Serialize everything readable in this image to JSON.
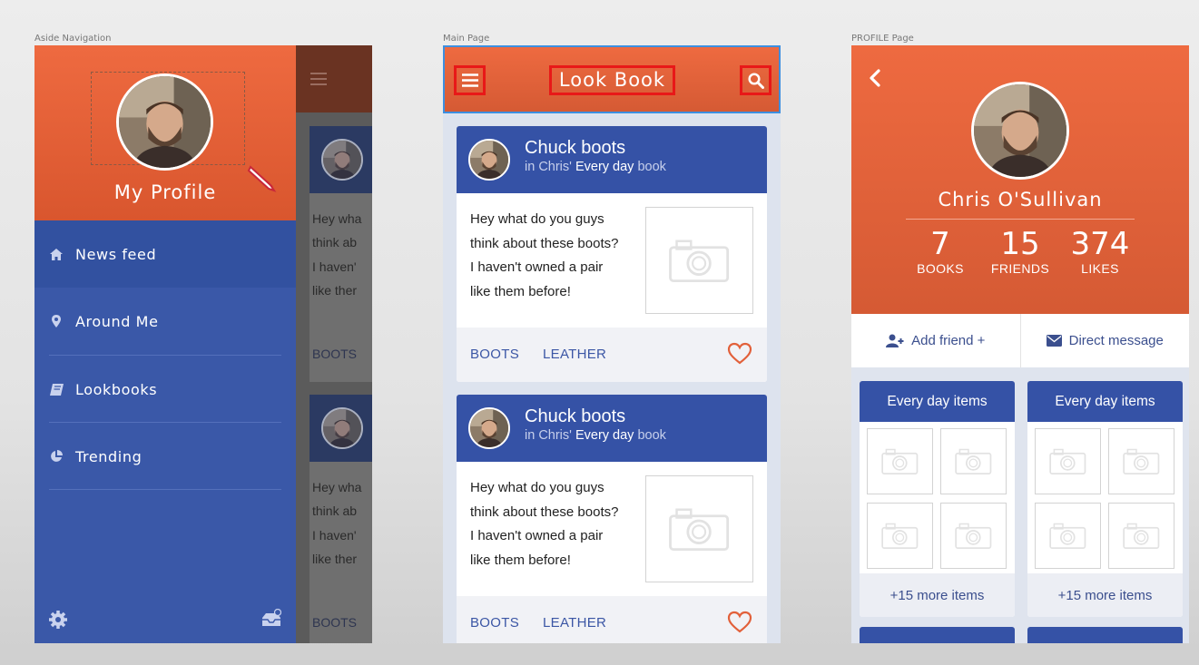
{
  "frames": {
    "aside_label": "Aside Navigation",
    "main_label": "Main Page",
    "profile_label": "PROFILE Page"
  },
  "aside": {
    "title": "My Profile",
    "items": [
      {
        "label": "News feed",
        "icon": "home-icon",
        "active": true
      },
      {
        "label": "Around Me",
        "icon": "map-pin-icon"
      },
      {
        "label": "Lookbooks",
        "icon": "book-icon"
      },
      {
        "label": "Trending",
        "icon": "pie-chart-icon"
      }
    ],
    "footer_icons": [
      "gear-icon",
      "inbox-icon"
    ],
    "peek_texts": [
      "Hey wha",
      "think ab",
      "I haven'",
      "like ther"
    ],
    "peek_tag": "BOOTS"
  },
  "main": {
    "title": "Look Book",
    "posts": [
      {
        "title": "Chuck boots",
        "sub_prefix": "in Chris' ",
        "sub_bold": "Every day",
        "sub_suffix": " book",
        "lines": [
          "Hey what do you guys",
          "think about these boots?",
          "I haven't owned a pair",
          "like them before!"
        ],
        "tags": [
          "BOOTS",
          "LEATHER"
        ]
      },
      {
        "title": "Chuck boots",
        "sub_prefix": "in Chris' ",
        "sub_bold": "Every day",
        "sub_suffix": " book",
        "lines": [
          "Hey what do you guys",
          "think about these boots?",
          "I haven't owned a pair",
          "like them before!"
        ],
        "tags": [
          "BOOTS",
          "LEATHER"
        ]
      }
    ]
  },
  "profile": {
    "name": "Chris O'Sullivan",
    "stats": [
      {
        "value": "7",
        "label": "BOOKS"
      },
      {
        "value": "15",
        "label": "FRIENDS"
      },
      {
        "value": "374",
        "label": "LIKES"
      }
    ],
    "add_friend": "Add friend +",
    "direct_message": "Direct message",
    "collections": [
      {
        "title": "Every day items",
        "more": "+15 more items"
      },
      {
        "title": "Every day items",
        "more": "+15 more items"
      }
    ]
  },
  "colors": {
    "accent": "#ee6a40",
    "brand_blue": "#3552a6",
    "highlight": "#e81818"
  }
}
